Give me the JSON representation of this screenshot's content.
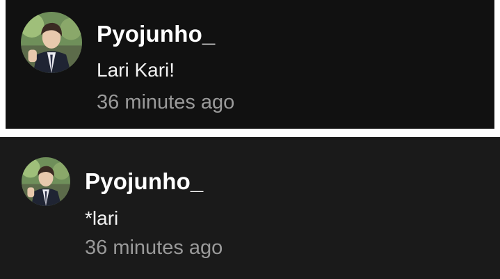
{
  "comments": [
    {
      "username": "Pyojunho_",
      "text": "Lari Kari!",
      "time": "36 minutes ago"
    },
    {
      "username": "Pyojunho_",
      "text": "*lari",
      "time": "36 minutes ago"
    }
  ],
  "colors": {
    "card_bg_1": "#111111",
    "card_bg_2": "#1a1a1a",
    "username": "#ffffff",
    "comment": "#f2f2f2",
    "timestamp": "#9a9a9a"
  }
}
